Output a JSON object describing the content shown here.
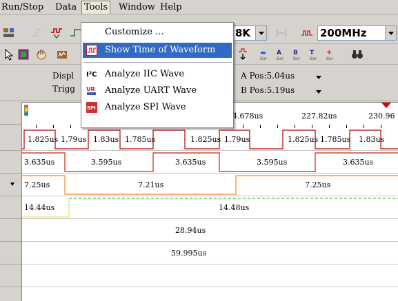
{
  "menubar": {
    "items": [
      "Run/Stop",
      "Data",
      "Tools",
      "Window",
      "Help"
    ]
  },
  "toolbar": {
    "depth_value": "8K",
    "rate_value": "200MHz"
  },
  "info": {
    "display_label": "Displ",
    "trigger_label": "Trigg",
    "a_pos": "A Pos:5.04us",
    "b_pos": "B Pos:5.19us"
  },
  "ruler": {
    "labels": [
      "4.678us",
      "227.82us",
      "230.96"
    ]
  },
  "tools_menu": {
    "items": [
      {
        "label": "Customize ...",
        "icon": "none"
      },
      {
        "label": "Show Time of Waveform",
        "icon": "waveform-time-icon"
      },
      {
        "label": "Analyze IIC Wave",
        "icon": "iic-icon"
      },
      {
        "label": "Analyze UART Wave",
        "icon": "uart-icon"
      },
      {
        "label": "Analyze SPI Wave",
        "icon": "spi-icon"
      }
    ]
  },
  "channels": {
    "row1": [
      "1.825us",
      "1.79us",
      "1.83us",
      "1.785us",
      "1.825us",
      "1.79us",
      "1.825us",
      "1.785us",
      "1.83us"
    ],
    "row2": [
      "3.635us",
      "3.595us",
      "3.635us",
      "3.595us",
      "3.635us"
    ],
    "row3": [
      "7.25us",
      "7.21us",
      "7.25us"
    ],
    "row4": [
      "14.44us",
      "14.48us"
    ],
    "row5": [
      "28.94us"
    ],
    "row6": [
      "59.995us"
    ]
  },
  "colors": {
    "row1_wave": "#b00000",
    "row2_wave": "#cc2200",
    "row3_wave": "#ff8020",
    "row4_wave": "#f0e070",
    "row4_dash": "#40c040",
    "highlight": "#316ac5"
  }
}
